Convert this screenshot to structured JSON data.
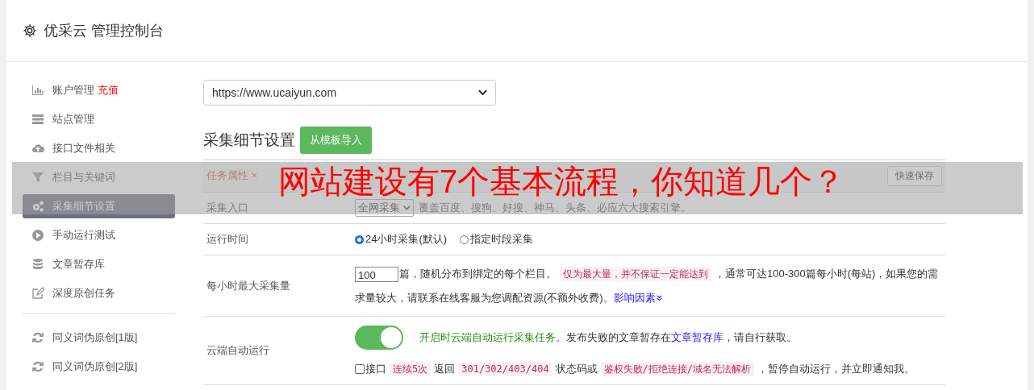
{
  "header": {
    "title": "优采云 管理控制台"
  },
  "sidebar": {
    "groups": [
      [
        {
          "label": "账户管理",
          "badge": "充值",
          "selected": false
        },
        {
          "label": "站点管理",
          "selected": false
        },
        {
          "label": "接口文件相关",
          "selected": false
        },
        {
          "label": "栏目与关键词",
          "selected": false
        },
        {
          "label": "采集细节设置",
          "selected": true
        },
        {
          "label": "手动运行测试",
          "selected": false
        },
        {
          "label": "文章暂存库",
          "selected": false
        },
        {
          "label": "深度原创任务",
          "selected": false
        }
      ],
      [
        {
          "label": "同义词伪原创[1版]",
          "selected": false
        },
        {
          "label": "同义词伪原创[2版]",
          "selected": false
        }
      ]
    ]
  },
  "site_select": {
    "value": "https://www.ucaiyun.com"
  },
  "section": {
    "title": "采集细节设置",
    "import_button": "从模板导入"
  },
  "task_header": {
    "label": "任务属性",
    "close": "×",
    "save_button": "快速保存"
  },
  "rows": [
    {
      "kind": "select",
      "label": "采集入口",
      "value": "全网采集",
      "note": "覆盖百度、搜狗、好搜、神马、头条、必应六大搜索引擎。"
    },
    {
      "kind": "radio",
      "label": "运行时间",
      "options": [
        {
          "label": "24小时采集(默认)",
          "selected": true
        },
        {
          "label": "指定时段采集",
          "selected": false
        }
      ]
    },
    {
      "kind": "number",
      "label": "每小时最大采集量",
      "value": "100",
      "segments": [
        {
          "kind": "text",
          "text": "篇，随机分布到绑定的每个栏目。"
        },
        {
          "kind": "code",
          "text": "仅为最大量，并不保证一定能达到"
        },
        {
          "kind": "text",
          "text": "，通常可达100-300篇每小时(每站)，如果您的需求量较大，请联系在线客服为您调配资源(不额外收费)。"
        },
        {
          "kind": "link",
          "text": "影响因素"
        }
      ]
    },
    {
      "kind": "toggle",
      "label": "云端自动运行",
      "on": true,
      "segments": [
        {
          "kind": "green",
          "text": "开启时云端自动运行采集任务"
        },
        {
          "kind": "text",
          "text": "。发布失败的文章暂存在"
        },
        {
          "kind": "link",
          "text": "文章暂存库"
        },
        {
          "kind": "text",
          "text": "，请自行获取。"
        }
      ],
      "check": {
        "checked": false,
        "segments": [
          {
            "kind": "text",
            "text": "接口"
          },
          {
            "kind": "code",
            "text": "连续5次"
          },
          {
            "kind": "text",
            "text": "返回"
          },
          {
            "kind": "code",
            "text": "301/302/403/404"
          },
          {
            "kind": "text",
            "text": "状态码或"
          },
          {
            "kind": "code",
            "text": "鉴权失败/拒绝连接/域名无法解析"
          },
          {
            "kind": "text",
            "text": "，暂停自动运行，并立即通知我。"
          }
        ]
      }
    }
  ],
  "banner": {
    "text": "网站建设有7个基本流程，你知道几个？"
  }
}
